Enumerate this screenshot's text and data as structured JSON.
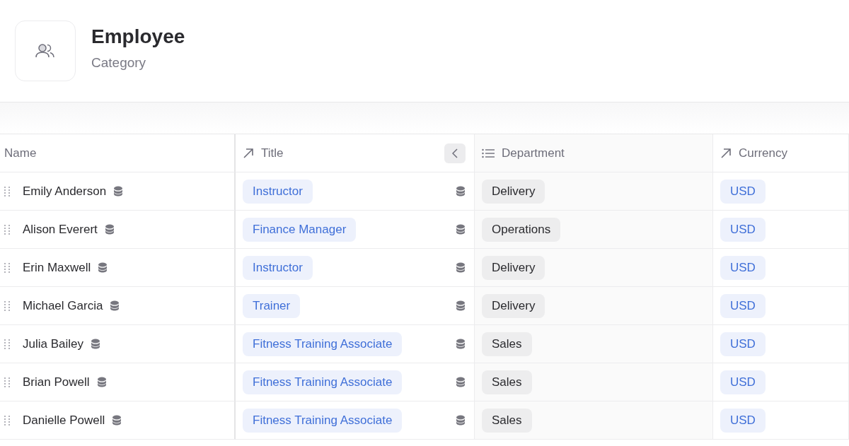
{
  "header": {
    "title": "Employee",
    "subtitle": "Category"
  },
  "table": {
    "columns": [
      {
        "label": "Name",
        "kind": "plain"
      },
      {
        "label": "Title",
        "kind": "link"
      },
      {
        "label": "Department",
        "kind": "list"
      },
      {
        "label": "Currency",
        "kind": "link"
      }
    ],
    "rows": [
      {
        "name": "Emily Anderson",
        "title": "Instructor",
        "department": "Delivery",
        "currency": "USD"
      },
      {
        "name": "Alison Everert",
        "title": "Finance Manager",
        "department": "Operations",
        "currency": "USD"
      },
      {
        "name": "Erin Maxwell",
        "title": "Instructor",
        "department": "Delivery",
        "currency": "USD"
      },
      {
        "name": "Michael Garcia",
        "title": "Trainer",
        "department": "Delivery",
        "currency": "USD"
      },
      {
        "name": "Julia Bailey",
        "title": "Fitness Training Associate",
        "department": "Sales",
        "currency": "USD"
      },
      {
        "name": "Brian Powell",
        "title": "Fitness Training Associate",
        "department": "Sales",
        "currency": "USD"
      },
      {
        "name": "Danielle Powell",
        "title": "Fitness Training Associate",
        "department": "Sales",
        "currency": "USD"
      }
    ]
  }
}
